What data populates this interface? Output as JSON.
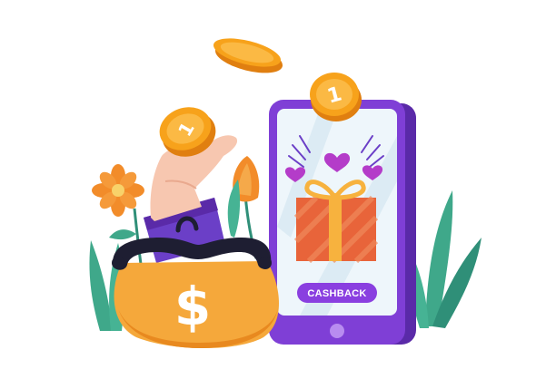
{
  "illustration": {
    "phone": {
      "cashback_button_label": "CASHBACK"
    },
    "coins": [
      {
        "digit": "1"
      },
      {
        "digit": "1"
      }
    ],
    "wallet": {
      "currency_symbol": "$"
    },
    "icons": [
      "coin-icon",
      "gift-box-icon",
      "heart-icon",
      "flower-icon",
      "leaf-icon",
      "wallet-icon",
      "hand-icon",
      "smartphone-icon"
    ],
    "colors": {
      "phone_body": "#7f3fd6",
      "phone_screen": "#eef6fb",
      "cashback_button": "#8a3fe0",
      "coin": "#f7a21b",
      "wallet_body": "#f5a83b",
      "wallet_clasp": "#1e1e32",
      "gift_box": "#e8643a",
      "gift_ribbon": "#f7b23e",
      "hearts": "#b43cc9",
      "leaves": "#3fa88a",
      "flower": "#f28c2a",
      "sleeve": "#6b3fc7",
      "hand": "#f7c7b0"
    }
  }
}
